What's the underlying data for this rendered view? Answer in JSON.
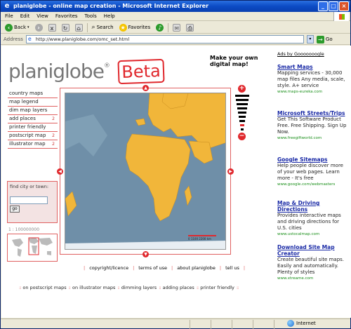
{
  "window": {
    "title": "planiglobe - online map creation - Microsoft Internet Explorer"
  },
  "menubar": [
    "File",
    "Edit",
    "View",
    "Favorites",
    "Tools",
    "Help"
  ],
  "toolbar": {
    "back": "Back",
    "search": "Search",
    "favorites": "Favorites"
  },
  "address": {
    "label": "Address",
    "url": "http://www.planiglobe.com/omc_set.html",
    "go": "Go"
  },
  "page": {
    "logo": "planiglobe",
    "registered": "®",
    "beta": "Beta",
    "tagline": "Make your own digital map!",
    "menu": [
      {
        "label": "country maps",
        "count": ""
      },
      {
        "label": "map legend",
        "count": ""
      },
      {
        "label": "dim map layers",
        "count": ""
      },
      {
        "label": "add places",
        "count": "2"
      },
      {
        "label": "printer friendly",
        "count": ""
      },
      {
        "label": "postscript map",
        "count": "2"
      },
      {
        "label": "illustrator map",
        "count": "2"
      }
    ],
    "find_label": "find city or town:",
    "find_button": "go",
    "scale": "1 : 100000000",
    "map_scale_text": "0   1100   2200 km",
    "footer_links": [
      "copyright/licence",
      "terms of use",
      "about planiglobe",
      "tell us"
    ],
    "bottom_links": [
      "on postscript maps",
      "on illustrator maps",
      "dimming layers",
      "adding places",
      "printer friendly"
    ]
  },
  "ads": {
    "heading": "Ads by Gooooooogle",
    "items": [
      {
        "title": "Smart Maps",
        "desc": "Mapping services - 30,000 map files Any media, scale, style. A+ service",
        "url": "www.maps-eureka.com"
      },
      {
        "title": "Microsoft Streets/Trips",
        "desc": "Get This Software Product Free. Free Shipping. Sign Up Now.",
        "url": "www.freegiftworld.com"
      },
      {
        "title": "Google Sitemaps",
        "desc": "Help people discover more of your web pages. Learn more - It's free",
        "url": "www.google.com/webmasters"
      },
      {
        "title": "Map & Driving Directions",
        "desc": "Provides interactive maps and driving directions for U.S. cities",
        "url": "www.ustocalmap.com"
      },
      {
        "title": "Download Site Map Creator",
        "desc": "Create beautiful site maps. Easily and automatically. Plenty of styles",
        "url": "www.xtreame.com"
      }
    ]
  },
  "status": {
    "zone": "Internet"
  },
  "colors": {
    "accent": "#e0282d",
    "land": "#f1b63a",
    "ocean": "#6f8fa8",
    "ad_title": "#1a2aa6"
  }
}
